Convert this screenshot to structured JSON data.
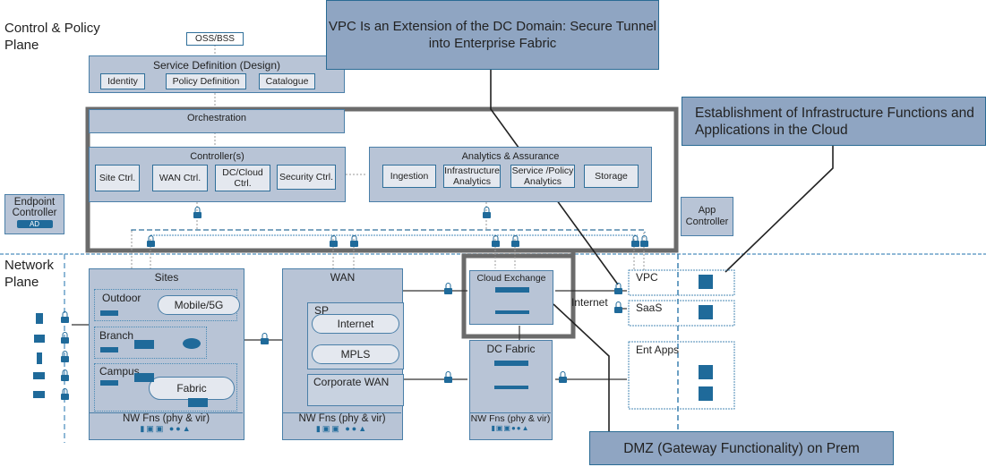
{
  "planes": {
    "control": "Control & Policy Plane",
    "network": "Network Plane"
  },
  "oss_bss": "OSS/BSS",
  "service_definition": {
    "title": "Service Definition (Design)",
    "items": [
      "Identity",
      "Policy Definition",
      "Catalogue"
    ]
  },
  "orchestration": "Orchestration",
  "controllers": {
    "title": "Controller(s)",
    "items": [
      "Site Ctrl.",
      "WAN Ctrl.",
      "DC/Cloud Ctrl.",
      "Security Ctrl."
    ]
  },
  "analytics": {
    "title": "Analytics & Assurance",
    "items": [
      "Ingestion",
      "Infrastructure Analytics",
      "Service /Policy Analytics",
      "Storage"
    ]
  },
  "endpoint_controller": {
    "label": "Endpoint Controller",
    "badge": "AD"
  },
  "app_controller": "App Controller",
  "callouts": {
    "vpc": "VPC Is an Extension of the DC Domain: Secure Tunnel into Enterprise Fabric",
    "cloud": "Establishment of Infrastructure Functions and Applications in the Cloud",
    "dmz": "DMZ (Gateway Functionality) on Prem"
  },
  "sites": {
    "title": "Sites",
    "outdoor": "Outdoor",
    "mobile": "Mobile/5G",
    "branch": "Branch",
    "campus": "Campus",
    "fabric": "Fabric",
    "nw_fns": "NW Fns (phy & vir)"
  },
  "wan": {
    "title": "WAN",
    "sp": "SP",
    "internet": "Internet",
    "mpls": "MPLS",
    "corporate": "Corporate WAN",
    "nw_fns": "NW Fns (phy & vir)"
  },
  "cloud_exchange": "Cloud Exchange",
  "internet_label": "Internet",
  "dc_fabric": {
    "title": "DC Fabric",
    "nw_fns": "NW Fns (phy & vir)"
  },
  "cloud": {
    "vpc": "VPC",
    "saas": "SaaS",
    "ent_apps": "Ent Apps"
  }
}
